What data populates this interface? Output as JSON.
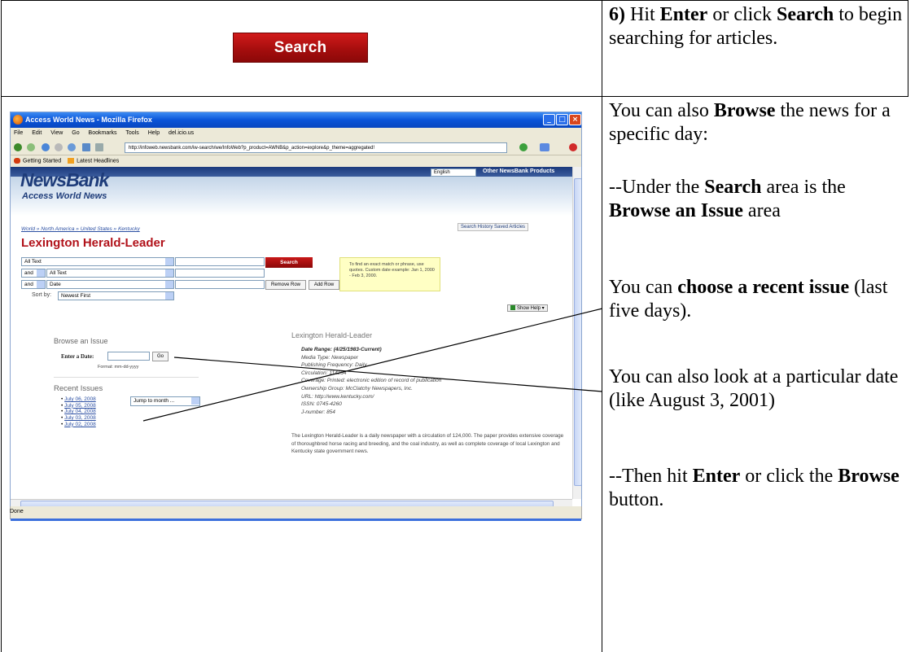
{
  "top_button": {
    "label": "Search"
  },
  "instructions": {
    "step6": {
      "num": "6)",
      "t1": " Hit ",
      "enter": "Enter",
      "t2": " or click ",
      "search": "Search",
      "t3": " to begin searching for articles."
    },
    "browse_intro": {
      "t1": "You can also ",
      "browse": "Browse",
      "t2": " the news for a specific day:"
    },
    "under_search": {
      "t1": "--Under the ",
      "search": "Search",
      "t2": " area is the ",
      "browse_issue": "Browse an Issue",
      "t3": " area"
    },
    "recent": {
      "t1": "You can ",
      "choose": "choose a recent issue",
      "t2": " (last five days)."
    },
    "date": {
      "text": "You can also look at a particular date (like August 3, 2001)"
    },
    "then": {
      "t1": "--Then hit ",
      "enter": "Enter",
      "t2": " or click the ",
      "browse": "Browse",
      "t3": " button."
    }
  },
  "browser": {
    "title": "Access World News - Mozilla Firefox",
    "menu": [
      "File",
      "Edit",
      "View",
      "Go",
      "Bookmarks",
      "Tools",
      "Help",
      "del.icio.us"
    ],
    "url": "http://infoweb.newsbank.com/iw-search/we/InfoWeb?p_product=AWNB&p_action=explore&p_theme=aggregated!",
    "bookmarks": {
      "getting_started": "Getting Started",
      "latest": "Latest Headlines"
    },
    "status": "Done"
  },
  "newsbank": {
    "logo": "NewsBank",
    "subtitle": "Access World News",
    "language": "English",
    "other_products": "Other NewsBank Products",
    "search_history": "Search History",
    "saved_articles": "Saved Articles",
    "breadcrumb": "World » North America » United States » Kentucky",
    "paper": "Lexington Herald-Leader",
    "rows": [
      {
        "field": "All Text"
      },
      {
        "op": "and",
        "field": "All Text"
      },
      {
        "op": "and",
        "field": "Date"
      }
    ],
    "sort_label": "Sort by:",
    "sort_value": "Newest First",
    "search_btn": "Search",
    "remove_row": "Remove Row",
    "add_row": "Add Row",
    "tip": "To find an exact match or phrase, use quotes. Custom date example: Jan 1, 2000 - Feb 3, 2000.",
    "show_help": "Show Help",
    "browse_heading": "Browse an Issue",
    "enter_date": "Enter a Date:",
    "go": "Go",
    "format": "Format: mm-dd-yyyy",
    "recent_heading": "Recent Issues",
    "recent_issues": [
      "July 06, 2008",
      "July 05, 2008",
      "July 04, 2008",
      "July 03, 2008",
      "July 02, 2008"
    ],
    "jump": "Jump to month ...",
    "info_heading": "Lexington Herald-Leader",
    "info": [
      "Date Range: (4/25/1983-Current)",
      "Media Type: Newspaper",
      "Publishing Frequency: Daily",
      "Circulation: 114234",
      "Coverage: Printed: electronic edition of record of publication",
      "Ownership Group: McClatchy Newspapers, Inc.",
      "URL: http://www.kentucky.com/",
      "ISSN: 0745-4260",
      "J-number: 854"
    ],
    "blurb": "The Lexington Herald-Leader is a daily newspaper with a circulation of 124,000. The paper provides extensive coverage of thoroughbred horse racing and breeding, and the coal industry, as well as complete coverage of local Lexington and Kentucky state government news."
  }
}
